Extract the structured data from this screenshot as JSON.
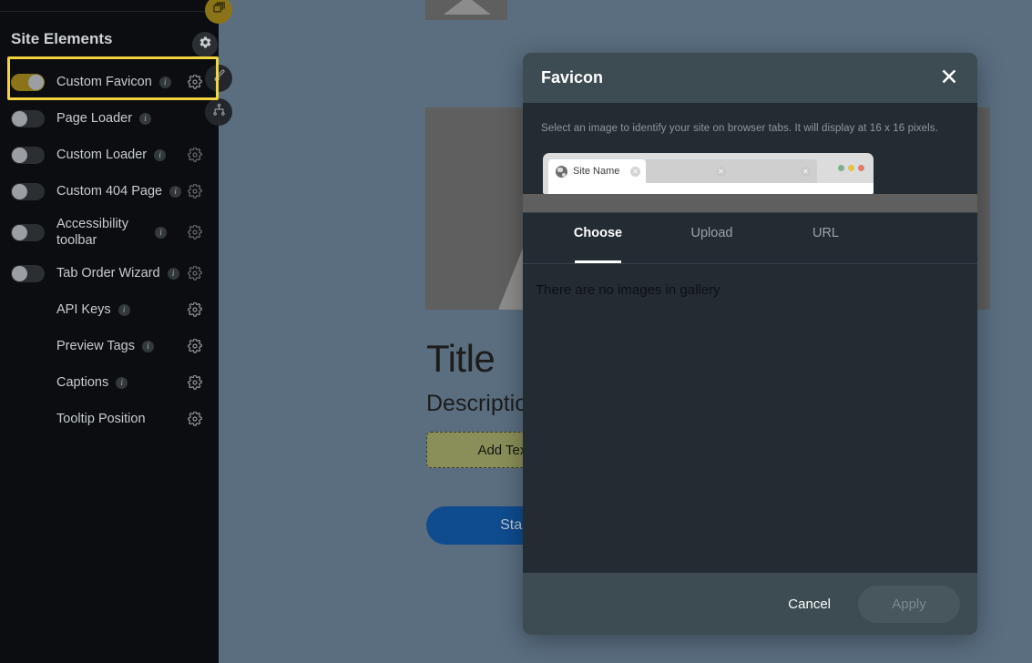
{
  "sidebar": {
    "title": "Site Elements",
    "header_gear_icon": "gear-icon",
    "float_buttons": [
      {
        "name": "layers-icon",
        "label": ""
      },
      {
        "name": "gear-icon",
        "label": ""
      },
      {
        "name": "brush-icon",
        "label": ""
      },
      {
        "name": "sitemap-icon",
        "label": ""
      }
    ],
    "items": [
      {
        "label": "Custom Favicon",
        "toggle": true,
        "toggle_on": true,
        "info": "i",
        "gear": true,
        "highlighted": true
      },
      {
        "label": "Page Loader",
        "toggle": true,
        "toggle_on": false,
        "info": "i",
        "gear": false,
        "highlighted": false
      },
      {
        "label": "Custom Loader",
        "toggle": true,
        "toggle_on": false,
        "info": "i",
        "gear": true,
        "highlighted": false
      },
      {
        "label": "Custom 404 Page",
        "toggle": true,
        "toggle_on": false,
        "info": "i",
        "gear": true,
        "highlighted": false
      },
      {
        "label": "Accessibility toolbar",
        "toggle": true,
        "toggle_on": false,
        "info": "i",
        "gear": true,
        "highlighted": false
      },
      {
        "label": "Tab Order Wizard",
        "toggle": true,
        "toggle_on": false,
        "info": "i",
        "gear": true,
        "highlighted": false
      },
      {
        "label": "API Keys",
        "toggle": false,
        "toggle_on": false,
        "info": "i",
        "gear": true,
        "highlighted": false
      },
      {
        "label": "Preview Tags",
        "toggle": false,
        "toggle_on": false,
        "info": "i",
        "gear": true,
        "highlighted": false
      },
      {
        "label": "Captions",
        "toggle": false,
        "toggle_on": false,
        "info": "i",
        "gear": true,
        "highlighted": false
      },
      {
        "label": "Tooltip Position",
        "toggle": false,
        "toggle_on": false,
        "info": "",
        "gear": true,
        "highlighted": false
      }
    ]
  },
  "canvas": {
    "title": "Title",
    "description": "Description",
    "add_text_label": "Add Text / M",
    "start_label": "Start"
  },
  "modal": {
    "title": "Favicon",
    "close_icon": "close-icon",
    "instructions": "Select an image to identify your site on browser tabs. It will display at 16 x 16 pixels.",
    "preview": {
      "tab_name": "Site Name",
      "favicon_icon": "globe-icon",
      "close_glyph": "×",
      "window_dots": [
        "#7cae8f",
        "#e0c44a",
        "#e07b6e"
      ]
    },
    "tabs": [
      {
        "label": "Choose",
        "active": true
      },
      {
        "label": "Upload",
        "active": false
      },
      {
        "label": "URL",
        "active": false
      }
    ],
    "empty_message": "There are no images in gallery",
    "cancel_label": "Cancel",
    "apply_label": "Apply"
  },
  "colors": {
    "highlight": "#f2d43c",
    "toggle_on": "#8a7417",
    "modal_header": "#3d4c52",
    "modal_body": "#242c33",
    "canvas": "#5a6e80",
    "sidebar": "#0b0d10"
  }
}
